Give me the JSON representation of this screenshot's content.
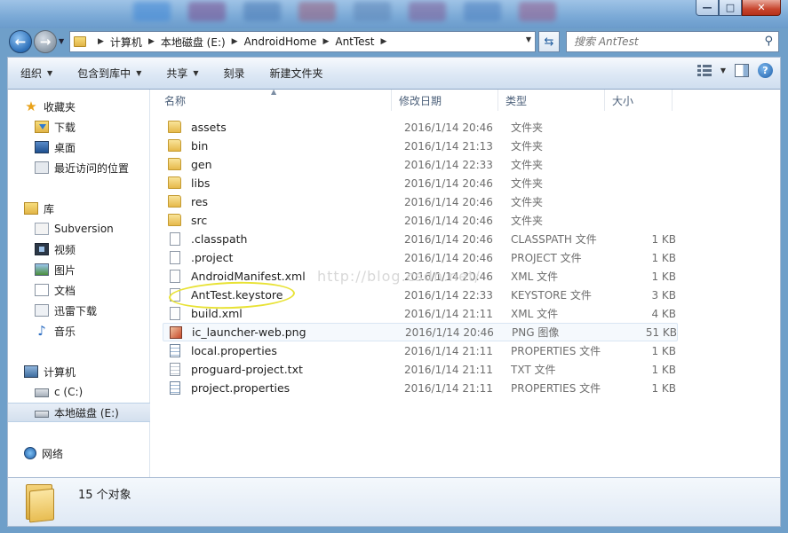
{
  "window": {
    "minimize_glyph": "—",
    "maximize_glyph": "□",
    "close_glyph": "✕"
  },
  "address_bar": {
    "crumbs": [
      "计算机",
      "本地磁盘 (E:)",
      "AndroidHome",
      "AntTest"
    ],
    "search_placeholder": "搜索 AntTest"
  },
  "toolbar": {
    "organize": "组织",
    "include_in_library": "包含到库中",
    "share": "共享",
    "burn": "刻录",
    "new_folder": "新建文件夹"
  },
  "sidebar": {
    "favorites": "收藏夹",
    "downloads": "下载",
    "desktop": "桌面",
    "recent": "最近访问的位置",
    "libraries": "库",
    "subversion": "Subversion",
    "videos": "视频",
    "pictures": "图片",
    "documents": "文档",
    "xunlei": "迅雷下载",
    "music": "音乐",
    "computer": "计算机",
    "c_drive": "c (C:)",
    "e_drive": "本地磁盘 (E:)",
    "network": "网络"
  },
  "columns": {
    "name": "名称",
    "date": "修改日期",
    "type": "类型",
    "size": "大小"
  },
  "files": [
    {
      "name": "assets",
      "date": "2016/1/14 20:46",
      "type": "文件夹",
      "size": "",
      "kind": "folder"
    },
    {
      "name": "bin",
      "date": "2016/1/14 21:13",
      "type": "文件夹",
      "size": "",
      "kind": "folder"
    },
    {
      "name": "gen",
      "date": "2016/1/14 22:33",
      "type": "文件夹",
      "size": "",
      "kind": "folder"
    },
    {
      "name": "libs",
      "date": "2016/1/14 20:46",
      "type": "文件夹",
      "size": "",
      "kind": "folder"
    },
    {
      "name": "res",
      "date": "2016/1/14 20:46",
      "type": "文件夹",
      "size": "",
      "kind": "folder"
    },
    {
      "name": "src",
      "date": "2016/1/14 20:46",
      "type": "文件夹",
      "size": "",
      "kind": "folder"
    },
    {
      "name": ".classpath",
      "date": "2016/1/14 20:46",
      "type": "CLASSPATH 文件",
      "size": "1 KB",
      "kind": "file"
    },
    {
      "name": ".project",
      "date": "2016/1/14 20:46",
      "type": "PROJECT 文件",
      "size": "1 KB",
      "kind": "file"
    },
    {
      "name": "AndroidManifest.xml",
      "date": "2016/1/14 20:46",
      "type": "XML 文件",
      "size": "1 KB",
      "kind": "xmlfile"
    },
    {
      "name": "AntTest.keystore",
      "date": "2016/1/14 22:33",
      "type": "KEYSTORE 文件",
      "size": "3 KB",
      "kind": "file"
    },
    {
      "name": "build.xml",
      "date": "2016/1/14 21:11",
      "type": "XML 文件",
      "size": "4 KB",
      "kind": "xmlfile"
    },
    {
      "name": "ic_launcher-web.png",
      "date": "2016/1/14 20:46",
      "type": "PNG 图像",
      "size": "51 KB",
      "kind": "png"
    },
    {
      "name": "local.properties",
      "date": "2016/1/14 21:11",
      "type": "PROPERTIES 文件",
      "size": "1 KB",
      "kind": "props"
    },
    {
      "name": "proguard-project.txt",
      "date": "2016/1/14 21:11",
      "type": "TXT 文件",
      "size": "1 KB",
      "kind": "txt"
    },
    {
      "name": "project.properties",
      "date": "2016/1/14 21:11",
      "type": "PROPERTIES 文件",
      "size": "1 KB",
      "kind": "props"
    }
  ],
  "watermark": "http://blog.csdn.net/",
  "details": {
    "count": "15 个对象"
  },
  "colors": {
    "accent": "#2c6fb8",
    "annotation": "#e8e235"
  }
}
